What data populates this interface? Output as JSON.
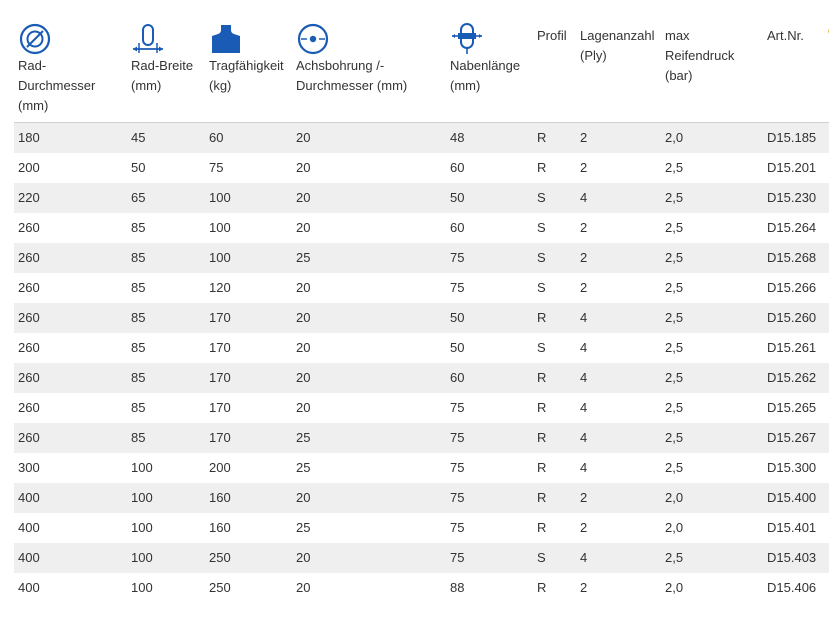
{
  "accent_color": "#1a5bb5",
  "columns": [
    {
      "key": "rad_durchmesser",
      "label": "Rad-\nDurchmesser\n(mm)",
      "icon": "wheel-diameter-icon"
    },
    {
      "key": "rad_breite",
      "label": "Rad-Breite\n(mm)",
      "icon": "wheel-width-icon"
    },
    {
      "key": "tragfaehigkeit",
      "label": "Tragfähigkeit\n(kg)",
      "icon": "load-capacity-icon"
    },
    {
      "key": "achsbohrung",
      "label": "Achsbohrung /-\nDurchmesser (mm)",
      "icon": "axle-bore-icon"
    },
    {
      "key": "nabenlaenge",
      "label": "Nabenlänge\n(mm)",
      "icon": "hub-length-icon"
    },
    {
      "key": "profil",
      "label": "Profil",
      "icon": ""
    },
    {
      "key": "lagenanzahl",
      "label": "Lagenanzahl\n(Ply)",
      "icon": ""
    },
    {
      "key": "reifendruck",
      "label": "max\nReifendruck\n(bar)",
      "icon": ""
    },
    {
      "key": "artnr",
      "label": "Art.Nr.",
      "icon": ""
    }
  ],
  "rows": [
    [
      "180",
      "45",
      "60",
      "20",
      "48",
      "R",
      "2",
      "2,0",
      "D15.185"
    ],
    [
      "200",
      "50",
      "75",
      "20",
      "60",
      "R",
      "2",
      "2,5",
      "D15.201"
    ],
    [
      "220",
      "65",
      "100",
      "20",
      "50",
      "S",
      "4",
      "2,5",
      "D15.230"
    ],
    [
      "260",
      "85",
      "100",
      "20",
      "60",
      "S",
      "2",
      "2,5",
      "D15.264"
    ],
    [
      "260",
      "85",
      "100",
      "25",
      "75",
      "S",
      "2",
      "2,5",
      "D15.268"
    ],
    [
      "260",
      "85",
      "120",
      "20",
      "75",
      "S",
      "2",
      "2,5",
      "D15.266"
    ],
    [
      "260",
      "85",
      "170",
      "20",
      "50",
      "R",
      "4",
      "2,5",
      "D15.260"
    ],
    [
      "260",
      "85",
      "170",
      "20",
      "50",
      "S",
      "4",
      "2,5",
      "D15.261"
    ],
    [
      "260",
      "85",
      "170",
      "20",
      "60",
      "R",
      "4",
      "2,5",
      "D15.262"
    ],
    [
      "260",
      "85",
      "170",
      "20",
      "75",
      "R",
      "4",
      "2,5",
      "D15.265"
    ],
    [
      "260",
      "85",
      "170",
      "25",
      "75",
      "R",
      "4",
      "2,5",
      "D15.267"
    ],
    [
      "300",
      "100",
      "200",
      "25",
      "75",
      "R",
      "4",
      "2,5",
      "D15.300"
    ],
    [
      "400",
      "100",
      "160",
      "20",
      "75",
      "R",
      "2",
      "2,0",
      "D15.400"
    ],
    [
      "400",
      "100",
      "160",
      "25",
      "75",
      "R",
      "2",
      "2,0",
      "D15.401"
    ],
    [
      "400",
      "100",
      "250",
      "20",
      "75",
      "S",
      "4",
      "2,5",
      "D15.403"
    ],
    [
      "400",
      "100",
      "250",
      "20",
      "88",
      "R",
      "2",
      "2,0",
      "D15.406"
    ]
  ]
}
